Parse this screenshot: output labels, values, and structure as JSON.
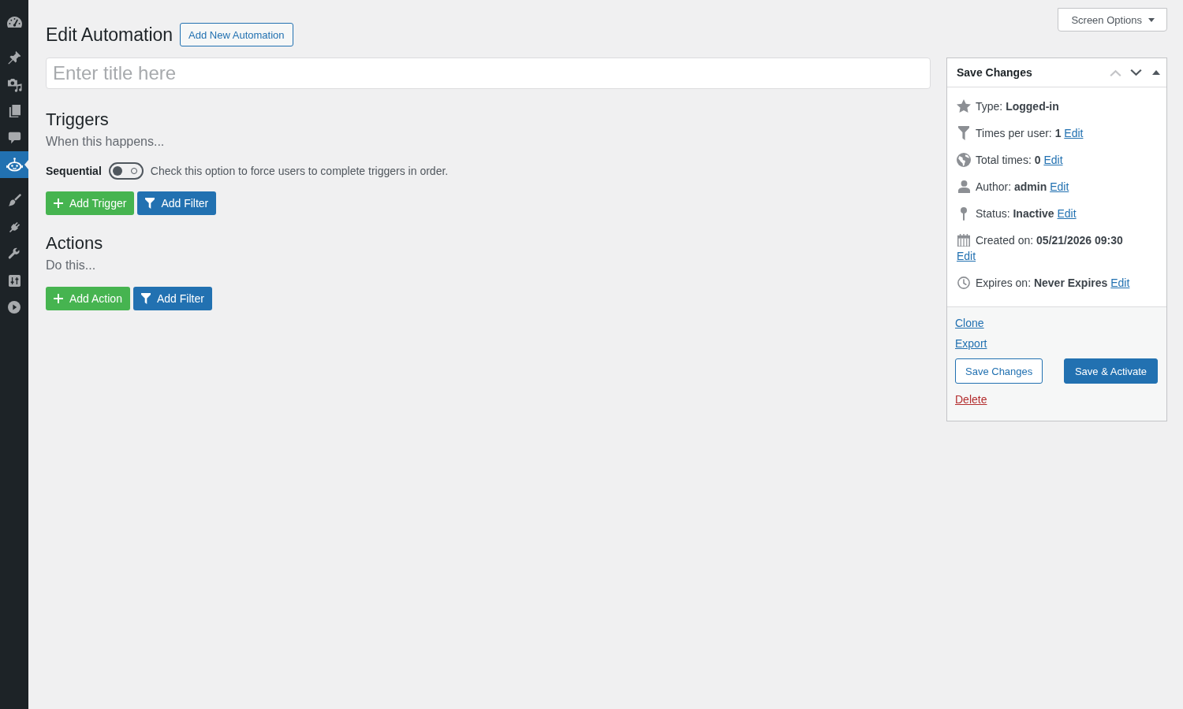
{
  "sidebar": {
    "groups": [
      {
        "items": [
          {
            "selected": false
          }
        ]
      },
      {
        "items": [
          {
            "selected": false
          },
          {
            "selected": false
          },
          {
            "selected": false
          },
          {
            "selected": false
          },
          {
            "selected": true
          }
        ]
      },
      {
        "items": [
          {
            "selected": false
          },
          {
            "selected": false
          },
          {
            "selected": false
          },
          {
            "selected": false
          },
          {
            "selected": false
          }
        ]
      }
    ]
  },
  "header": {
    "title": "Edit Automation",
    "add_new_button": "Add New Automation",
    "screen_options": "Screen Options"
  },
  "title_field": {
    "placeholder": "Enter title here"
  },
  "sections": [
    {
      "heading": "Triggers",
      "description": "When this happens...",
      "toggle": {
        "label": "Sequential",
        "on": false,
        "help": "Check this option to force users to complete triggers in order."
      },
      "buttons": [
        {
          "kind": "add",
          "label": "Add Trigger"
        },
        {
          "kind": "filter",
          "label": "Add Filter"
        }
      ]
    },
    {
      "heading": "Actions",
      "description": "Do this...",
      "buttons": [
        {
          "kind": "add",
          "label": "Add Action"
        },
        {
          "kind": "filter",
          "label": "Add Filter"
        }
      ]
    }
  ],
  "panel": {
    "title": "Save Changes",
    "controls": [
      {
        "kind": "up",
        "disabled": true
      },
      {
        "kind": "down",
        "disabled": false
      },
      {
        "kind": "collapse",
        "disabled": false
      }
    ],
    "details": [
      {
        "text": "Type: **Logged-in**"
      },
      {
        "text": "Times per user: **1**",
        "link": "Edit"
      },
      {
        "text": "Total times: **0**",
        "link": "Edit"
      },
      {
        "text": "Author: **admin**",
        "link": "Edit"
      },
      {
        "text": "Status: **Inactive**",
        "link": "Edit"
      },
      {
        "text": "Created on: **05/21/2026 09:30**",
        "link": "Edit"
      },
      {
        "text": "Expires on: **Never Expires**",
        "link": "Edit"
      }
    ],
    "links": [
      "Clone",
      "Export"
    ],
    "buttons": [
      {
        "kind": "secondary",
        "label": "Save Changes"
      },
      {
        "kind": "primary",
        "label": "Save & Activate"
      }
    ],
    "delete_link": "Delete"
  }
}
